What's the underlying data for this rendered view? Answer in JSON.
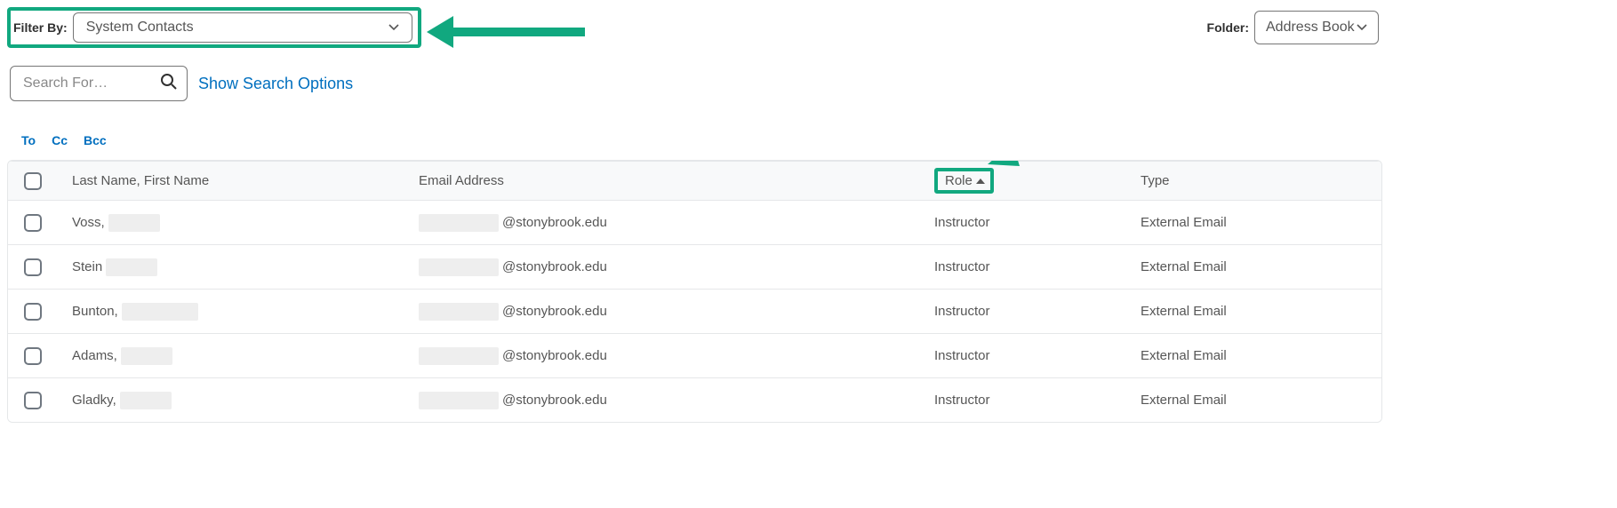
{
  "filter": {
    "label": "Filter By:",
    "value": "System Contacts"
  },
  "folder": {
    "label": "Folder:",
    "value": "Address Book"
  },
  "search": {
    "placeholder": "Search For…",
    "show_options": "Show Search Options"
  },
  "recipients": {
    "to": "To",
    "cc": "Cc",
    "bcc": "Bcc"
  },
  "table": {
    "headers": {
      "name": "Last Name, First Name",
      "email": "Email Address",
      "role": "Role",
      "type": "Type"
    },
    "email_domain": "@stonybrook.edu",
    "rows": [
      {
        "last": "Voss,",
        "role": "Instructor",
        "type": "External Email"
      },
      {
        "last": "Stein",
        "role": "Instructor",
        "type": "External Email"
      },
      {
        "last": "Bunton,",
        "role": "Instructor",
        "type": "External Email"
      },
      {
        "last": "Adams,",
        "role": "Instructor",
        "type": "External Email"
      },
      {
        "last": "Gladky,",
        "role": "Instructor",
        "type": "External Email"
      }
    ]
  },
  "annotations": {
    "highlight_color": "#11a87f"
  }
}
